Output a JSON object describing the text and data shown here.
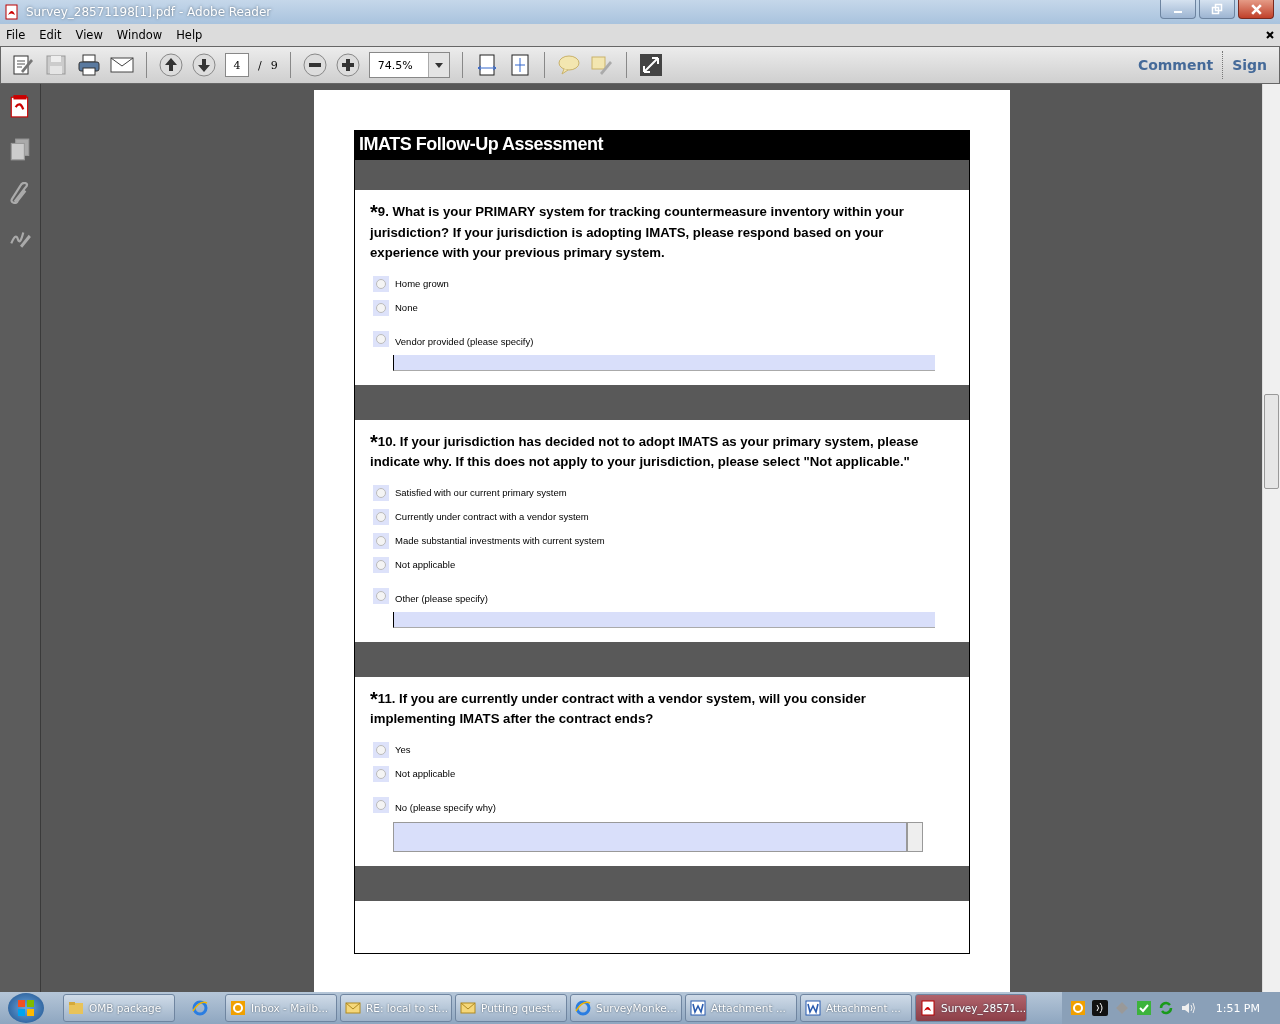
{
  "window": {
    "title": "Survey_28571198[1].pdf - Adobe Reader"
  },
  "menu": [
    "File",
    "Edit",
    "View",
    "Window",
    "Help"
  ],
  "toolbar": {
    "page": "4",
    "page_sep": "/",
    "page_count": "9",
    "zoom": "74.5%",
    "tasks": [
      "Comment",
      "Sign"
    ]
  },
  "document": {
    "header": "IMATS Follow-Up Assessment",
    "questions": [
      {
        "marker": "*",
        "text": "9. What is your PRIMARY system for tracking countermeasure inventory within your jurisdiction? If your jurisdiction is adopting IMATS, please respond based on your experience with your previous primary system.",
        "options": [
          {
            "label": "Home grown",
            "selected": false
          },
          {
            "label": "None",
            "selected": false
          },
          {
            "label": "Vendor provided (please specify)",
            "selected": false
          }
        ],
        "kind": "line"
      },
      {
        "marker": "*",
        "text": "10. If your jurisdiction has decided not to adopt IMATS as your primary system, please indicate why. If this does not apply to your jurisdiction, please select \"Not applicable.\"",
        "options": [
          {
            "label": "Satisfied with our current primary system",
            "selected": false
          },
          {
            "label": "Currently under contract with a vendor system",
            "selected": false
          },
          {
            "label": "Made substantial investments with current system",
            "selected": false
          },
          {
            "label": "Not applicable",
            "selected": false
          },
          {
            "label": "Other (please specify)",
            "selected": false
          }
        ],
        "kind": "line"
      },
      {
        "marker": "*",
        "text": "11. If you are currently under contract with a vendor system, will you consider implementing IMATS after the contract ends?",
        "options": [
          {
            "label": "Yes",
            "selected": false
          },
          {
            "label": "Not applicable",
            "selected": false
          },
          {
            "label": "No (please specify why)",
            "selected": false
          }
        ],
        "kind": "textarea"
      }
    ]
  },
  "taskbar": {
    "items": [
      {
        "kind": "folder",
        "label": "OMB package",
        "selected": false
      },
      {
        "kind": "browser",
        "selected": false
      },
      {
        "kind": "outlook",
        "label": "Inbox - Mailb...",
        "selected": false
      },
      {
        "kind": "mail",
        "label": "RE: local to st...",
        "selected": false
      },
      {
        "kind": "mail",
        "label": "Putting quest...",
        "selected": false
      },
      {
        "kind": "browser",
        "label": "SurveyMonke...",
        "selected": false
      },
      {
        "kind": "word",
        "label": "Attachment ...",
        "selected": false
      },
      {
        "kind": "word",
        "label": "Attachment ...",
        "selected": false
      },
      {
        "kind": "pdf",
        "label": "Survey_28571...",
        "selected": true
      }
    ],
    "clock": "1:51 PM"
  }
}
